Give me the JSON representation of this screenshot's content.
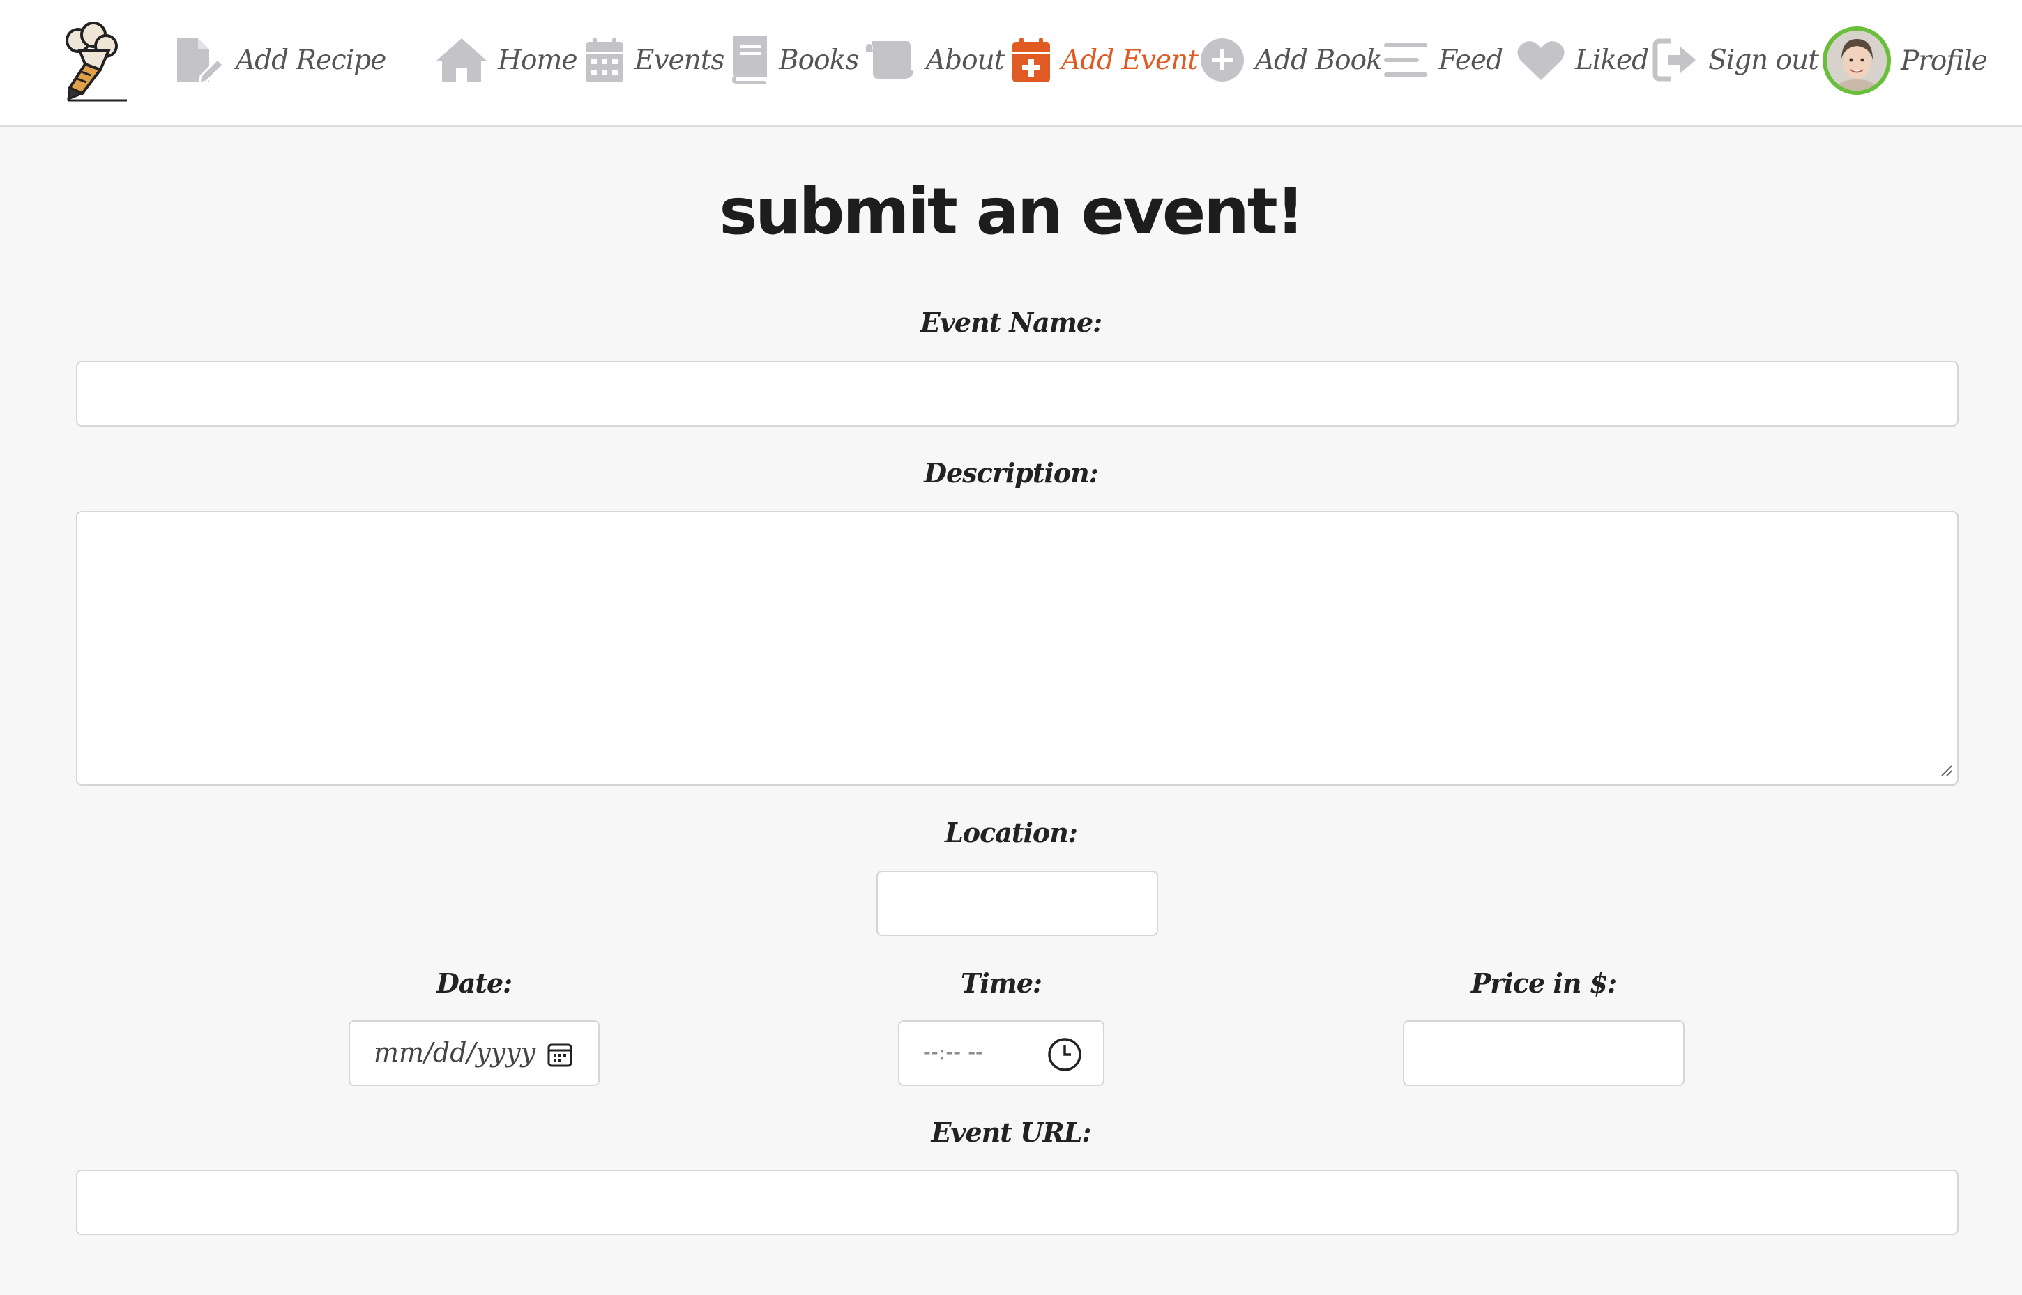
{
  "nav": {
    "add_recipe": "Add Recipe",
    "home": "Home",
    "events": "Events",
    "books": "Books",
    "about": "About",
    "add_event": "Add Event",
    "add_book": "Add Book",
    "feed": "Feed",
    "liked": "Liked",
    "sign_out": "Sign out",
    "profile": "Profile",
    "active_item": "Add Event"
  },
  "colors": {
    "accent": "#e05a23",
    "icon_gray": "#c4c4c8",
    "avatar_ring": "#6abf3a",
    "background": "#f7f7f7"
  },
  "form": {
    "title": "submit an event!",
    "event_name_label": "Event Name:",
    "event_name_value": "",
    "description_label": "Description:",
    "description_value": "",
    "location_label": "Location:",
    "location_value": "",
    "date_label": "Date:",
    "date_placeholder": "mm/dd/yyyy",
    "time_label": "Time:",
    "time_placeholder": "--:-- --",
    "price_label": "Price in $:",
    "price_value": "",
    "url_label": "Event URL:",
    "url_value": ""
  }
}
